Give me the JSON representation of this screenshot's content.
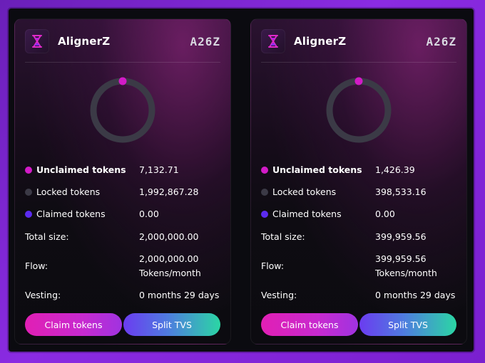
{
  "colors": {
    "unclaimed": "#d21bc7",
    "locked": "#3b3a46",
    "claimed": "#5b2bf0",
    "ring_track": "#3b3a46",
    "ring_marker": "#d21bc7"
  },
  "cards": [
    {
      "logo_icon": "hourglass-icon",
      "brand": "AlignerZ",
      "ticker": "A26Z",
      "unclaimed_label": "Unclaimed tokens",
      "unclaimed_value": "7,132.71",
      "locked_label": "Locked tokens",
      "locked_value": "1,992,867.28",
      "claimed_label": "Claimed tokens",
      "claimed_value": "0.00",
      "total_label": "Total size:",
      "total_value": "2,000,000.00",
      "flow_label": "Flow:",
      "flow_value": "2,000,000.00",
      "flow_unit": "Tokens/month",
      "vesting_label": "Vesting:",
      "vesting_value": "0 months 29 days",
      "claim_button": "Claim tokens",
      "split_button": "Split TVS"
    },
    {
      "logo_icon": "hourglass-icon",
      "brand": "AlignerZ",
      "ticker": "A26Z",
      "unclaimed_label": "Unclaimed tokens",
      "unclaimed_value": "1,426.39",
      "locked_label": "Locked tokens",
      "locked_value": "398,533.16",
      "claimed_label": "Claimed tokens",
      "claimed_value": "0.00",
      "total_label": "Total size:",
      "total_value": "399,959.56",
      "flow_label": "Flow:",
      "flow_value": "399,959.56",
      "flow_unit": "Tokens/month",
      "vesting_label": "Vesting:",
      "vesting_value": "0 months 29 days",
      "claim_button": "Claim tokens",
      "split_button": "Split TVS"
    }
  ]
}
